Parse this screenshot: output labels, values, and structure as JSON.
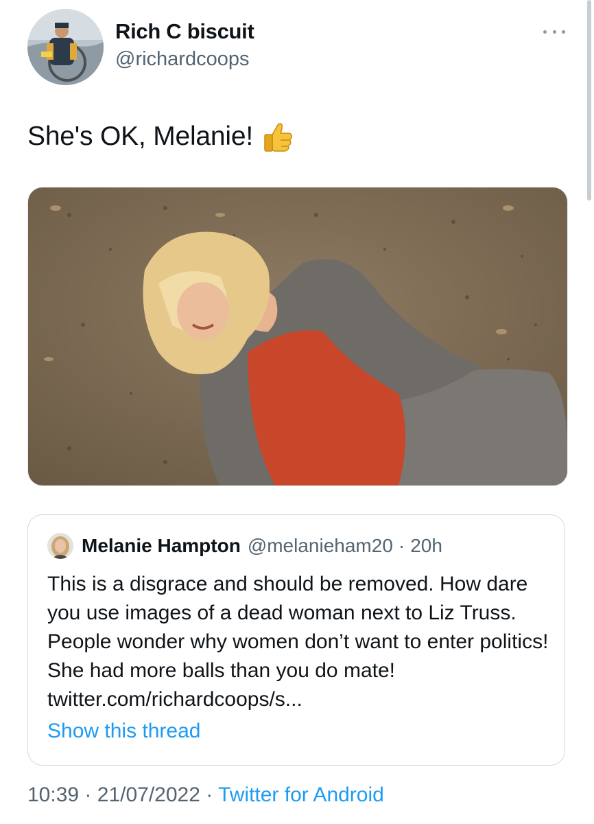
{
  "tweet": {
    "author": {
      "display_name": "Rich C biscuit",
      "handle": "@richardcoops"
    },
    "text": "She's OK, Melanie!",
    "emoji": "thumbs-up",
    "timestamp_time": "10:39",
    "separator": "·",
    "timestamp_date": "21/07/2022",
    "source": "Twitter for Android"
  },
  "quoted_tweet": {
    "display_name": "Melanie Hampton",
    "handle": "@melanieham20",
    "separator": "·",
    "time": "20h",
    "text": "This is a disgrace and should be removed. How dare you use images of a dead woman next to Liz Truss. People wonder why women don’t want to enter politics! She had more balls than you do mate! twitter.com/richardcoops/s...",
    "show_thread": "Show this thread"
  },
  "icons": {
    "more": "more-horizontal-icon",
    "emoji": "thumbs-up-icon"
  },
  "colors": {
    "link": "#1d9bf0",
    "secondary_text": "#536471",
    "primary_text": "#0f1419",
    "border": "#cfd9de"
  }
}
